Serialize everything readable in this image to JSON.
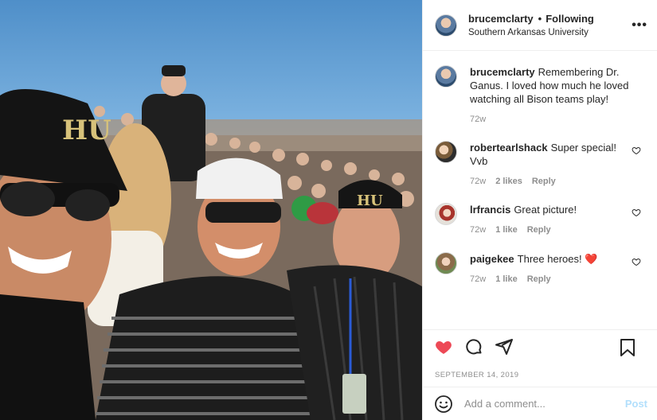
{
  "post": {
    "username": "brucemclarty",
    "follow_label": "Following",
    "dot": "•",
    "location": "Southern Arkansas University",
    "more_icon": "ellipsis-icon"
  },
  "caption": {
    "username": "brucemclarty",
    "text": "Remembering Dr. Ganus. I loved how much he loved watching all Bison teams play!",
    "time": "72w"
  },
  "comments": [
    {
      "username": "robertearlshack",
      "text": "Super special! Vvb",
      "time": "72w",
      "likes": "2 likes",
      "reply": "Reply"
    },
    {
      "username": "lrfrancis",
      "text": "Great picture!",
      "time": "72w",
      "likes": "1 like",
      "reply": "Reply"
    },
    {
      "username": "paigekee",
      "text": "Three heroes!",
      "emoji": "❤️",
      "time": "72w",
      "likes": "1 like",
      "reply": "Reply"
    }
  ],
  "date": "SEPTEMBER 14, 2019",
  "add_comment": {
    "placeholder": "Add a comment...",
    "post_label": "Post"
  },
  "colors": {
    "like_red": "#ed4956",
    "post_blue": "#b2dffc",
    "meta_gray": "#8e8e8e"
  },
  "icons": [
    "heart-filled-icon",
    "comment-icon",
    "share-icon",
    "bookmark-icon",
    "emoji-icon"
  ]
}
